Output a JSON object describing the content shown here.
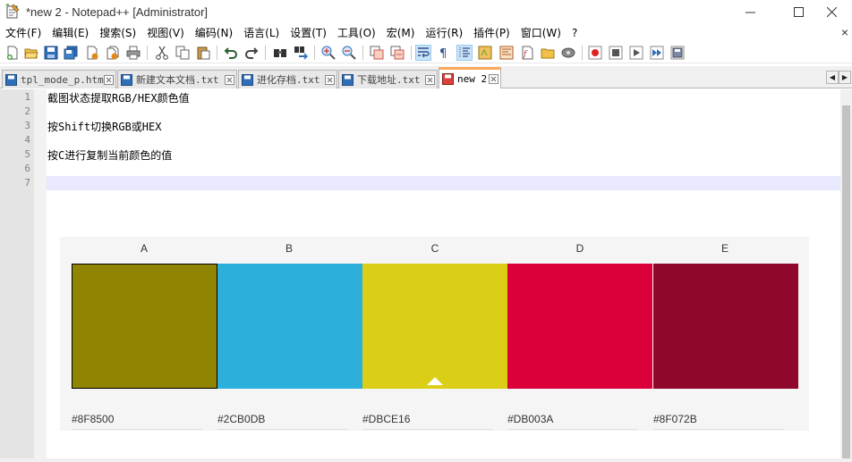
{
  "window": {
    "title": "*new 2 - Notepad++ [Administrator]",
    "minimize_glyph": "—",
    "maximize_glyph": "☐",
    "close_glyph": "✕"
  },
  "menu": {
    "items": [
      {
        "label": "文件(F)"
      },
      {
        "label": "编辑(E)"
      },
      {
        "label": "搜索(S)"
      },
      {
        "label": "视图(V)"
      },
      {
        "label": "编码(N)"
      },
      {
        "label": "语言(L)"
      },
      {
        "label": "设置(T)"
      },
      {
        "label": "工具(O)"
      },
      {
        "label": "宏(M)"
      },
      {
        "label": "运行(R)"
      },
      {
        "label": "插件(P)"
      },
      {
        "label": "窗口(W)"
      },
      {
        "label": "?"
      }
    ],
    "close_glyph": "×"
  },
  "toolbar": {
    "buttons": [
      {
        "icon": "new-file-icon"
      },
      {
        "icon": "open-file-icon"
      },
      {
        "icon": "save-icon"
      },
      {
        "icon": "save-all-icon"
      },
      {
        "icon": "close-icon"
      },
      {
        "icon": "close-all-icon"
      },
      {
        "icon": "print-icon"
      },
      {
        "icon": "cut-icon"
      },
      {
        "icon": "copy-icon"
      },
      {
        "icon": "paste-icon"
      },
      {
        "icon": "undo-icon"
      },
      {
        "icon": "redo-icon"
      },
      {
        "icon": "find-icon"
      },
      {
        "icon": "replace-icon"
      },
      {
        "icon": "zoom-in-icon"
      },
      {
        "icon": "zoom-out-icon"
      },
      {
        "icon": "sync-vertical-icon"
      },
      {
        "icon": "sync-horizontal-icon"
      },
      {
        "icon": "word-wrap-icon"
      },
      {
        "icon": "show-all-chars-icon"
      },
      {
        "icon": "indent-guide-icon"
      },
      {
        "icon": "udl-icon"
      },
      {
        "icon": "doc-map-icon"
      },
      {
        "icon": "function-list-icon"
      },
      {
        "icon": "folder-workspace-icon"
      },
      {
        "icon": "monitoring-icon"
      },
      {
        "icon": "record-macro-icon"
      },
      {
        "icon": "stop-macro-icon"
      },
      {
        "icon": "play-macro-icon"
      },
      {
        "icon": "run-macro-multiple-icon"
      },
      {
        "icon": "save-macro-icon"
      }
    ]
  },
  "tabs": [
    {
      "label": "tpl_mode_p.html",
      "active": false
    },
    {
      "label": "新建文本文档.txt",
      "active": false
    },
    {
      "label": "进化存档.txt",
      "active": false
    },
    {
      "label": "下载地址.txt",
      "active": false
    },
    {
      "label": "new 2",
      "active": true
    }
  ],
  "tab_scroll": {
    "left": "◀",
    "right": "▶"
  },
  "editor": {
    "lines": [
      {
        "num": "1",
        "text": "截图状态提取RGB/HEX颜色值"
      },
      {
        "num": "2",
        "text": ""
      },
      {
        "num": "3",
        "text": "按Shift切换RGB或HEX"
      },
      {
        "num": "4",
        "text": ""
      },
      {
        "num": "5",
        "text": "按C进行复制当前颜色的值"
      },
      {
        "num": "6",
        "text": ""
      },
      {
        "num": "7",
        "text": ""
      }
    ],
    "current_line": 7
  },
  "palette": {
    "columns": [
      {
        "label": "A",
        "hex": "#8F8500",
        "color": "#8F8500",
        "selected": true,
        "marker": false
      },
      {
        "label": "B",
        "hex": "#2CB0DB",
        "color": "#2CB0DB",
        "selected": false,
        "marker": false
      },
      {
        "label": "C",
        "hex": "#DBCE16",
        "color": "#DBCE16",
        "selected": false,
        "marker": true
      },
      {
        "label": "D",
        "hex": "#DB003A",
        "color": "#DB003A",
        "selected": false,
        "marker": false
      },
      {
        "label": "E",
        "hex": "#8F072B",
        "color": "#8F072B",
        "selected": false,
        "marker": false
      }
    ]
  },
  "colors": {
    "tab_active_accent": "#fca85d",
    "current_line_bg": "#e8e8ff",
    "gutter_bg": "#e4e4e4"
  }
}
